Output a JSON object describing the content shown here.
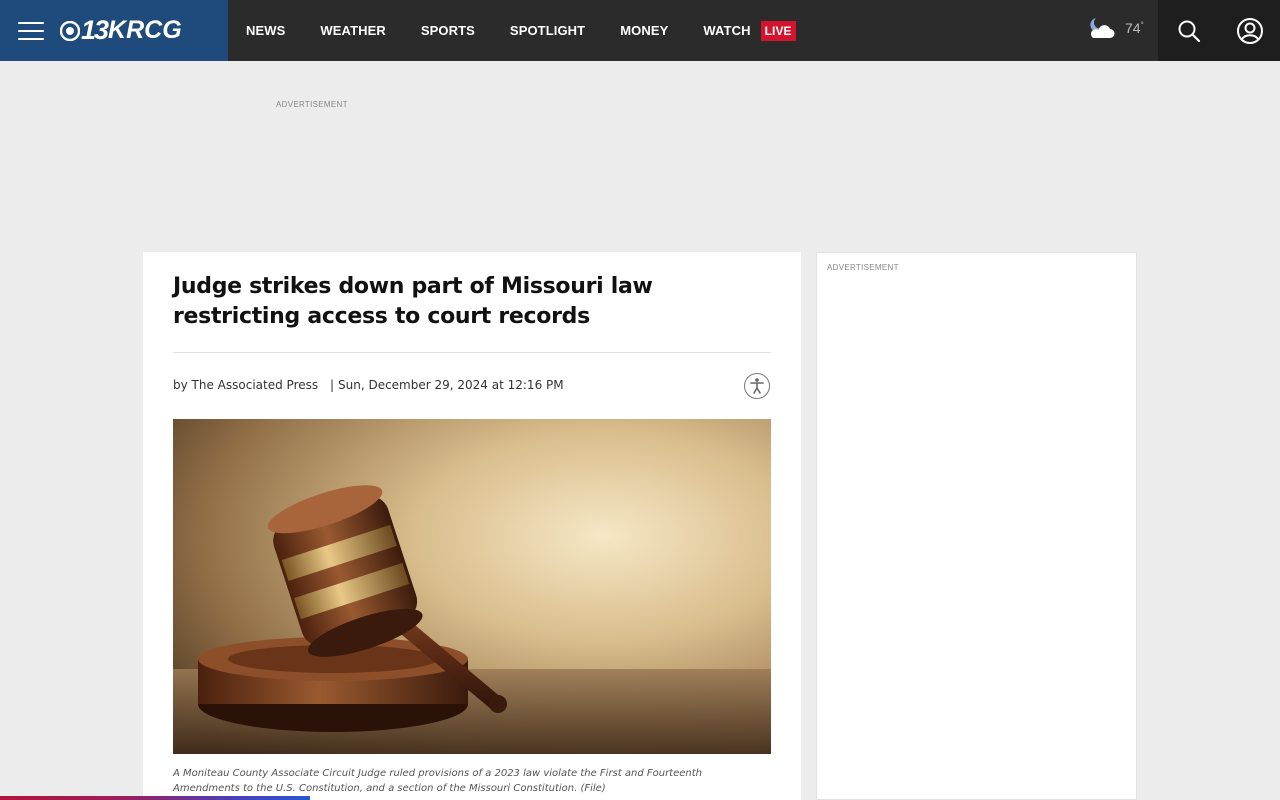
{
  "header": {
    "logo_number": "13",
    "logo_call": "KRCG",
    "nav": [
      {
        "label": "NEWS"
      },
      {
        "label": "WEATHER"
      },
      {
        "label": "SPORTS"
      },
      {
        "label": "SPOTLIGHT"
      },
      {
        "label": "MONEY"
      },
      {
        "label": "WATCH"
      }
    ],
    "live_badge": "LIVE",
    "weather": {
      "temp": "74",
      "degree": "°",
      "icon": "partly-cloudy-night-icon"
    },
    "colors": {
      "brand_blue": "#1f4a7c",
      "bar": "#2b2b2b",
      "live_red": "#d4132e"
    }
  },
  "ads": {
    "top_label": "ADVERTISEMENT",
    "side_label": "ADVERTISEMENT"
  },
  "article": {
    "headline": "Judge strikes down part of Missouri law restricting access to court records",
    "byline_prefix": "by",
    "author": "The Associated Press",
    "separator": "|",
    "date": "Sun, December 29, 2024 at 12:16 PM",
    "caption": "A Moniteau County Associate Circuit Judge ruled provisions of a 2023 law violate the First and Fourteenth Amendments to the U.S. Constitution, and a section of the Missouri Constitution. (File)",
    "image_subject": "gavel-photo"
  }
}
